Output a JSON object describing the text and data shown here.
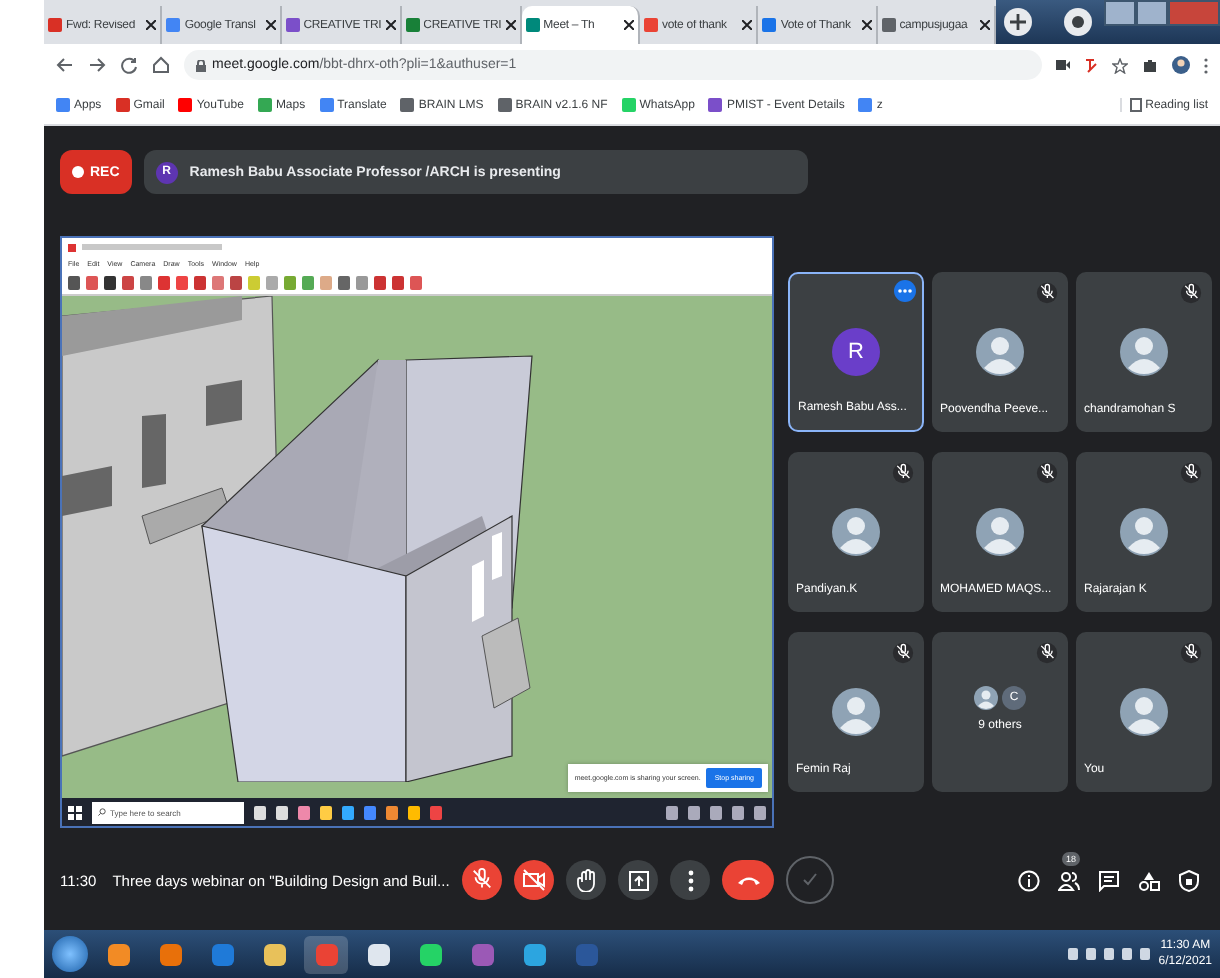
{
  "browser": {
    "tabs": [
      {
        "title": "Fwd: Revised",
        "color": "#d93025",
        "selected": false
      },
      {
        "title": "Google Transl",
        "color": "#4285f4",
        "selected": false
      },
      {
        "title": "CREATIVE TRI",
        "color": "#7b4fc9",
        "selected": false
      },
      {
        "title": "CREATIVE TRI",
        "color": "#188038",
        "selected": false
      },
      {
        "title": "Meet – Th",
        "color": "#00897b",
        "selected": true
      },
      {
        "title": "vote of thank",
        "color": "#ea4335",
        "selected": false
      },
      {
        "title": "Vote of Thank",
        "color": "#1a73e8",
        "selected": false
      },
      {
        "title": "campusjugaa",
        "color": "#5f6368",
        "selected": false
      }
    ],
    "url_host": "meet.google.com",
    "url_path": "/bbt-dhrx-oth?pli=1&authuser=1",
    "bookmarks": [
      {
        "label": "Apps",
        "color": "#4285f4"
      },
      {
        "label": "Gmail",
        "color": "#d93025"
      },
      {
        "label": "YouTube",
        "color": "#ff0000"
      },
      {
        "label": "Maps",
        "color": "#34a853"
      },
      {
        "label": "Translate",
        "color": "#4285f4"
      },
      {
        "label": "BRAIN LMS",
        "color": "#5f6368"
      },
      {
        "label": "BRAIN v2.1.6 NF",
        "color": "#5f6368"
      },
      {
        "label": "WhatsApp",
        "color": "#25d366"
      },
      {
        "label": "PMIST - Event Details",
        "color": "#7b4fc9"
      },
      {
        "label": "z",
        "color": "#4285f4"
      }
    ],
    "reading_list": "Reading list"
  },
  "meet": {
    "rec_label": "REC",
    "presenter_initial": "R",
    "presenting_text": "Ramesh Babu Associate Professor /ARCH is presenting",
    "shared_screen": {
      "menu": [
        "File",
        "Edit",
        "View",
        "Camera",
        "Draw",
        "Tools",
        "Window",
        "Help"
      ],
      "search_placeholder": "Type here to search",
      "sharing_notice": "meet.google.com is sharing your screen.",
      "stop_sharing": "Stop sharing"
    },
    "participants": [
      {
        "name": "Ramesh Babu Ass...",
        "kind": "initial",
        "initial": "R",
        "speaking": true
      },
      {
        "name": "Poovendha Peeve...",
        "kind": "photo",
        "speaking": false
      },
      {
        "name": "chandramohan S",
        "kind": "photo",
        "speaking": false
      },
      {
        "name": "Pandiyan.K",
        "kind": "photo",
        "speaking": false
      },
      {
        "name": "MOHAMED MAQS...",
        "kind": "photo",
        "speaking": false
      },
      {
        "name": "Rajarajan K",
        "kind": "photo",
        "speaking": false
      },
      {
        "name": "Femin Raj",
        "kind": "photo",
        "speaking": false
      },
      {
        "name": "9 others",
        "kind": "others",
        "initial": "C",
        "speaking": false
      },
      {
        "name": "You",
        "kind": "photo",
        "speaking": false
      }
    ],
    "time": "11:30",
    "meeting_title": "Three days webinar on \"Building Design and Buil...",
    "controls": [
      {
        "kind": "mic",
        "off": true
      },
      {
        "kind": "camera",
        "off": true
      },
      {
        "kind": "hand",
        "off": false
      },
      {
        "kind": "present",
        "off": false
      },
      {
        "kind": "more",
        "off": false
      },
      {
        "kind": "end"
      },
      {
        "kind": "ring"
      }
    ],
    "people_count": "18"
  },
  "taskbar": {
    "time": "11:30 AM",
    "date": "6/12/2021"
  }
}
